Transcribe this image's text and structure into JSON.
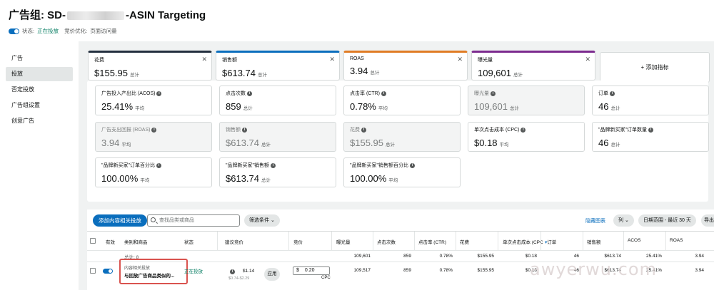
{
  "header": {
    "title_prefix": "广告组: SD-",
    "title_suffix": "-ASIN Targeting",
    "status_label": "状态:",
    "status_value": "正在投放",
    "bid_opt_label": "竞价优化:",
    "bid_opt_value": "页面访问量"
  },
  "nav": {
    "items": [
      {
        "label": "广告"
      },
      {
        "label": "投放"
      },
      {
        "label": "否定投放"
      },
      {
        "label": "广告组设置"
      },
      {
        "label": "创意广告"
      }
    ]
  },
  "metrics_top": [
    {
      "label": "花费",
      "value": "$155.95",
      "sub": "总计",
      "accent": "#232f3e"
    },
    {
      "label": "销售额",
      "value": "$613.74",
      "sub": "总计",
      "accent": "#0a6ebd"
    },
    {
      "label": "ROAS",
      "value": "3.94",
      "sub": "总计",
      "accent": "#e07b24"
    },
    {
      "label": "曝光量",
      "value": "109,601",
      "sub": "总计",
      "accent": "#7b2a8e"
    }
  ],
  "add_metric_label": "+ 添加指标",
  "metrics_grid": [
    {
      "label": "广告投入产出比 (ACOS)",
      "value": "25.41%",
      "sub": "平均",
      "gray": false
    },
    {
      "label": "点击次数",
      "value": "859",
      "sub": "总计",
      "gray": false
    },
    {
      "label": "点击率 (CTR)",
      "value": "0.78%",
      "sub": "平均",
      "gray": false
    },
    {
      "label": "曝光量",
      "value": "109,601",
      "sub": "总计",
      "gray": true
    },
    {
      "label": "订单",
      "value": "46",
      "sub": "总计",
      "gray": false
    },
    {
      "label": "广告支出回报 (ROAS)",
      "value": "3.94",
      "sub": "平均",
      "gray": true
    },
    {
      "label": "销售额",
      "value": "$613.74",
      "sub": "总计",
      "gray": true
    },
    {
      "label": "花费",
      "value": "$155.95",
      "sub": "总计",
      "gray": true
    },
    {
      "label": "单次点击成本 (CPC)",
      "value": "$0.18",
      "sub": "平均",
      "gray": false
    },
    {
      "label": "\"品牌新买家\"订单数量",
      "value": "46",
      "sub": "总计",
      "gray": false
    },
    {
      "label": "\"品牌新买家\"订单百分比",
      "value": "100.00%",
      "sub": "平均",
      "gray": false
    },
    {
      "label": "\"品牌新买家\"销售额",
      "value": "$613.74",
      "sub": "总计",
      "gray": false
    },
    {
      "label": "\"品牌新买家\"销售额百分比",
      "value": "100.00%",
      "sub": "平均",
      "gray": false
    }
  ],
  "toolbar": {
    "add_button": "添加内容相关投放",
    "search_placeholder": "查找品类或商品",
    "filter_button": "筛选条件",
    "hide_chart": "隐藏图表",
    "columns_button": "列",
    "date_range": "日期范围 - 最近 30 天",
    "export_button": "导出"
  },
  "table": {
    "headers": {
      "active": "有效",
      "category": "类别和商品",
      "status": "状态",
      "suggested_bid": "建议竞价",
      "bid": "竞价",
      "impressions": "曝光量",
      "clicks": "点击次数",
      "ctr": "点击率 (CTR)",
      "spend": "花费",
      "cpc": "单次点击成本 (CPC)",
      "orders": "订单",
      "sales": "销售额",
      "acos": "ACOS",
      "roas": "ROAS"
    },
    "total": {
      "label": "总计: 8",
      "impressions": "109,601",
      "clicks": "859",
      "ctr": "0.78%",
      "spend": "$155.95",
      "cpc": "$0.18",
      "orders": "46",
      "sales": "$613.74",
      "acos": "25.41%",
      "roas": "3.94"
    },
    "row": {
      "type_label": "内容相关投放",
      "target": "与回放广告商品类似的...",
      "status": "正在投放",
      "suggested": "$1.14",
      "suggested_range": "$0.74-$2.29",
      "apply": "应用",
      "bid_currency": "$",
      "bid_value": "0.20",
      "bid_unit": "CPC",
      "impressions": "109,517",
      "clicks": "859",
      "ctr": "0.78%",
      "spend": "$155.95",
      "cpc": "$0.18",
      "orders": "46",
      "sales": "$613.74",
      "acos": "25.41%",
      "roas": "3.94"
    }
  },
  "watermark": "awyerwu.com"
}
